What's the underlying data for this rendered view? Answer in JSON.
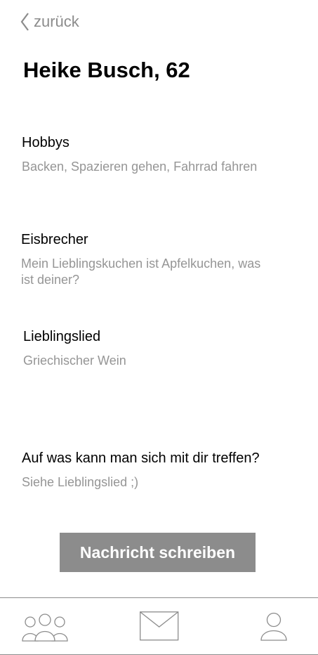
{
  "header": {
    "back_label": "zurück"
  },
  "profile": {
    "title": "Heike Busch, 62"
  },
  "sections": [
    {
      "label": "Hobbys",
      "value": "Backen, Spazieren gehen, Fahrrad fahren"
    },
    {
      "label": "Eisbrecher",
      "value": "Mein Lieblingskuchen ist Apfelkuchen, was ist deiner?"
    },
    {
      "label": "Lieblingslied",
      "value": "Griechischer Wein"
    },
    {
      "label": "Auf was kann man sich mit dir treffen?",
      "value": "Siehe Lieblingslied ;)"
    }
  ],
  "action": {
    "button_label": "Nachricht schreiben"
  },
  "bottom_nav": {
    "items": [
      {
        "icon": "group-icon"
      },
      {
        "icon": "envelope-icon"
      },
      {
        "icon": "person-icon"
      }
    ]
  },
  "colors": {
    "accent_gray": "#8c8c8c",
    "secondary_text": "#959595"
  }
}
